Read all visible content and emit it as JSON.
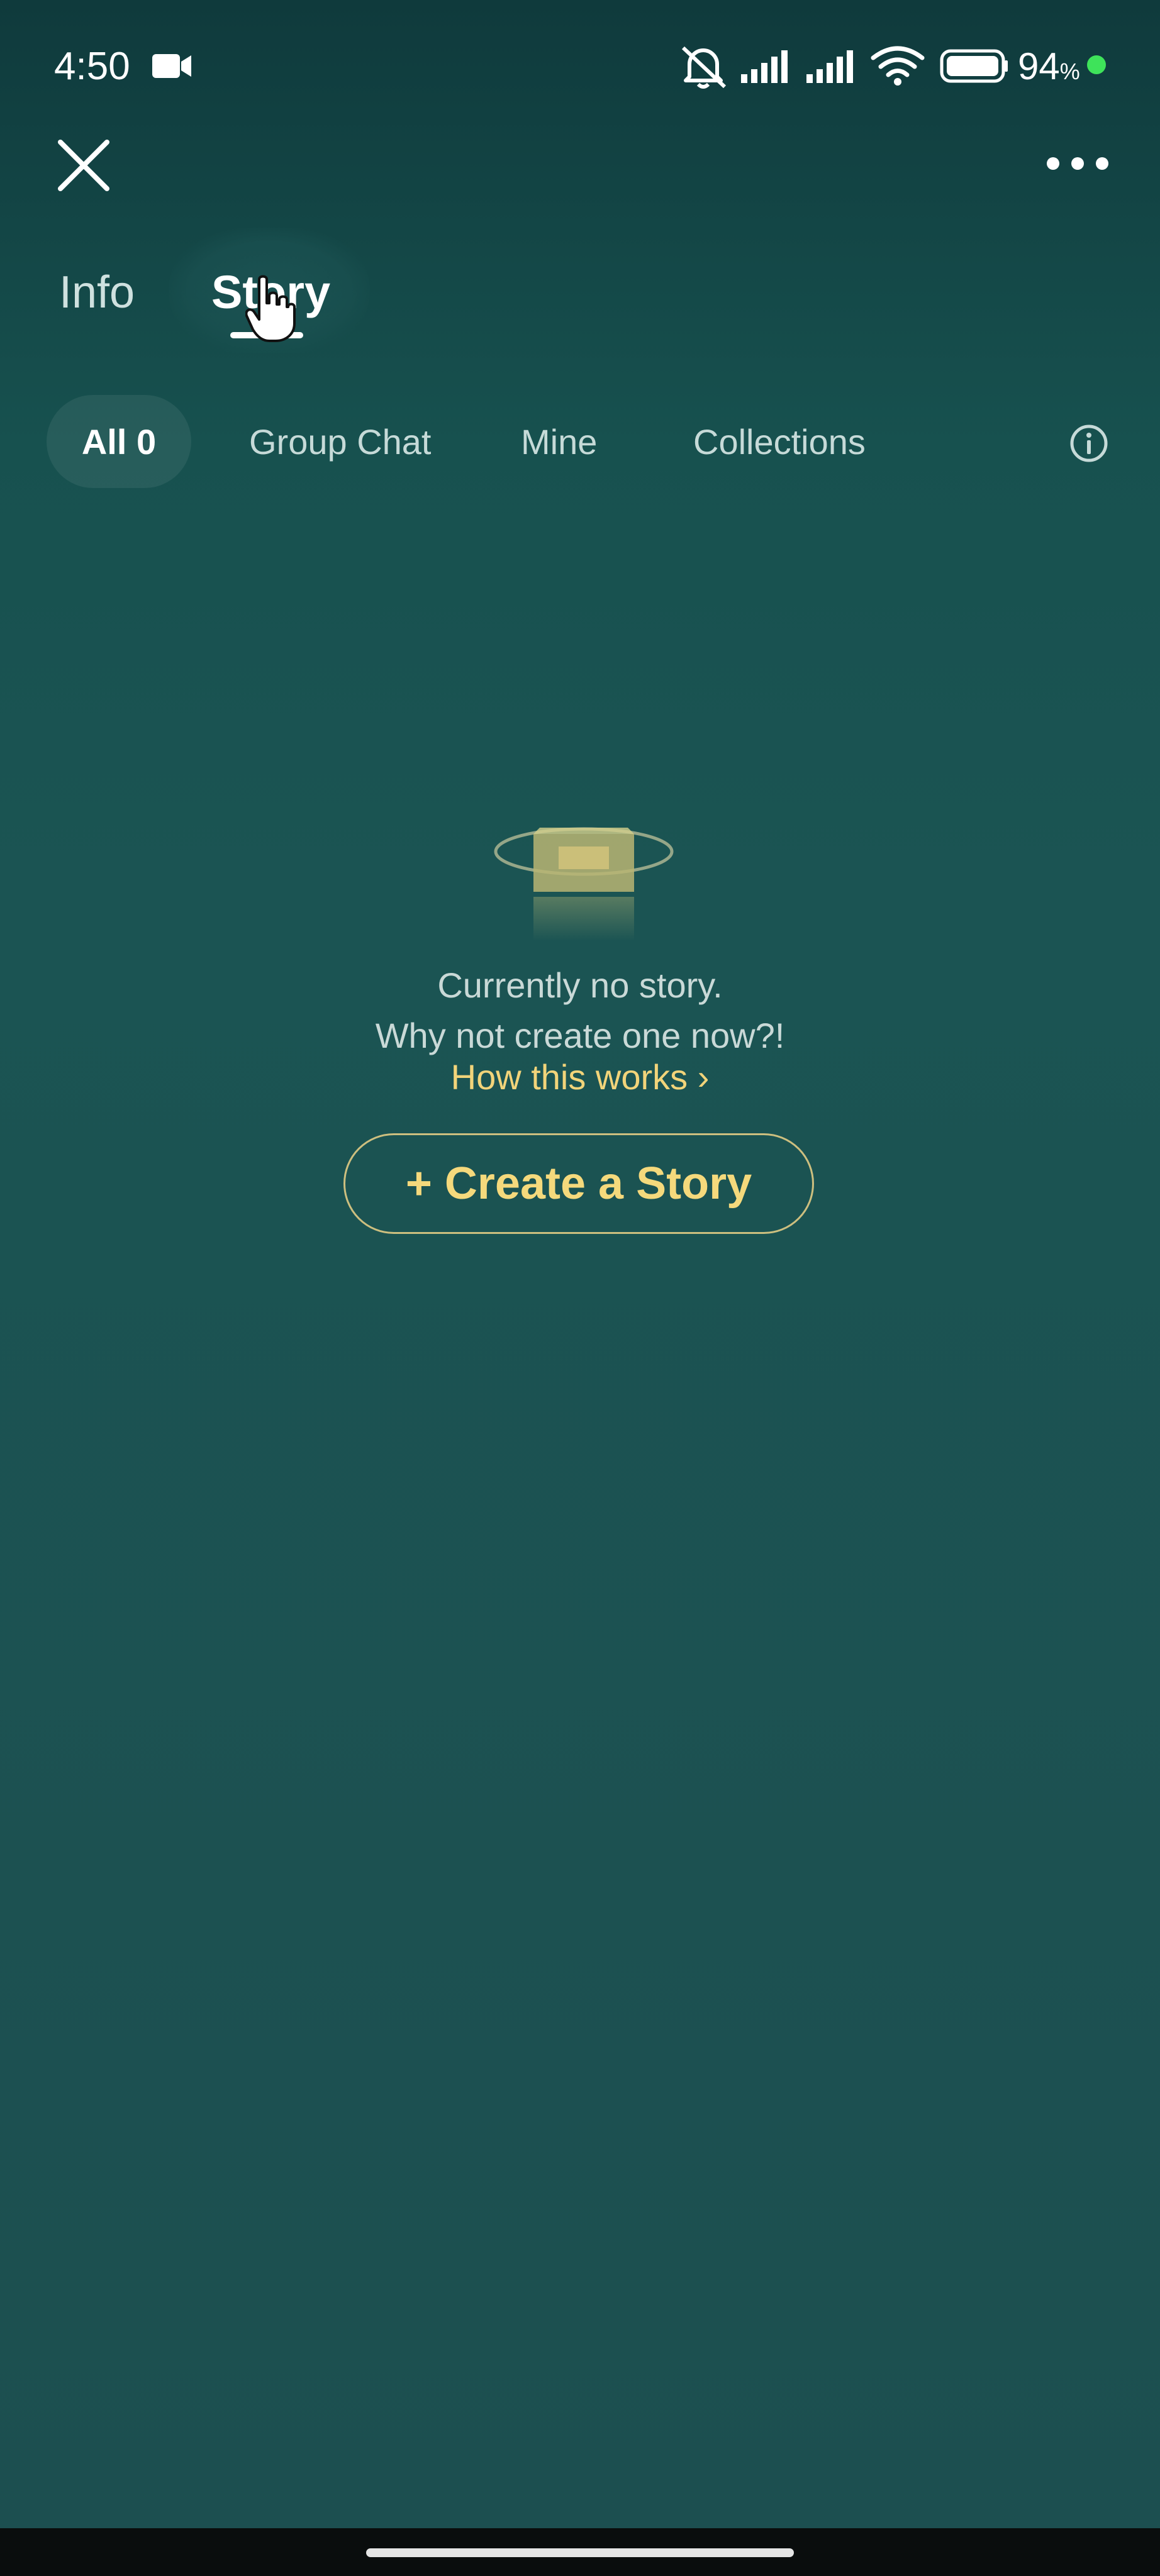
{
  "status_bar": {
    "time": "4:50",
    "battery_percent": "94",
    "battery_unit": "%",
    "icons": [
      "video-camera-icon",
      "mute-icon",
      "signal-icon",
      "signal-icon",
      "wifi-icon",
      "battery-icon",
      "charging-dot-icon"
    ],
    "charging_color": "#3ee35a"
  },
  "top_bar": {
    "close_icon": "close-icon",
    "more_icon": "more-dots-icon"
  },
  "tabs": [
    {
      "label": "Info",
      "active": false
    },
    {
      "label": "Story",
      "active": true
    }
  ],
  "filters": [
    {
      "label": "All 0",
      "active": true
    },
    {
      "label": "Group Chat",
      "active": false
    },
    {
      "label": "Mine",
      "active": false
    },
    {
      "label": "Collections",
      "active": false
    }
  ],
  "filter_info_icon": "info-circle-icon",
  "empty_state": {
    "illustration": "empty-inbox-icon",
    "line1": "Currently no story.",
    "line2": "Why not create one now?!",
    "link": "How this works ›",
    "button": "+ Create a Story"
  },
  "colors": {
    "accent": "#f5d97c",
    "background": "#1b5453",
    "text_muted": "#c9d9d7"
  }
}
